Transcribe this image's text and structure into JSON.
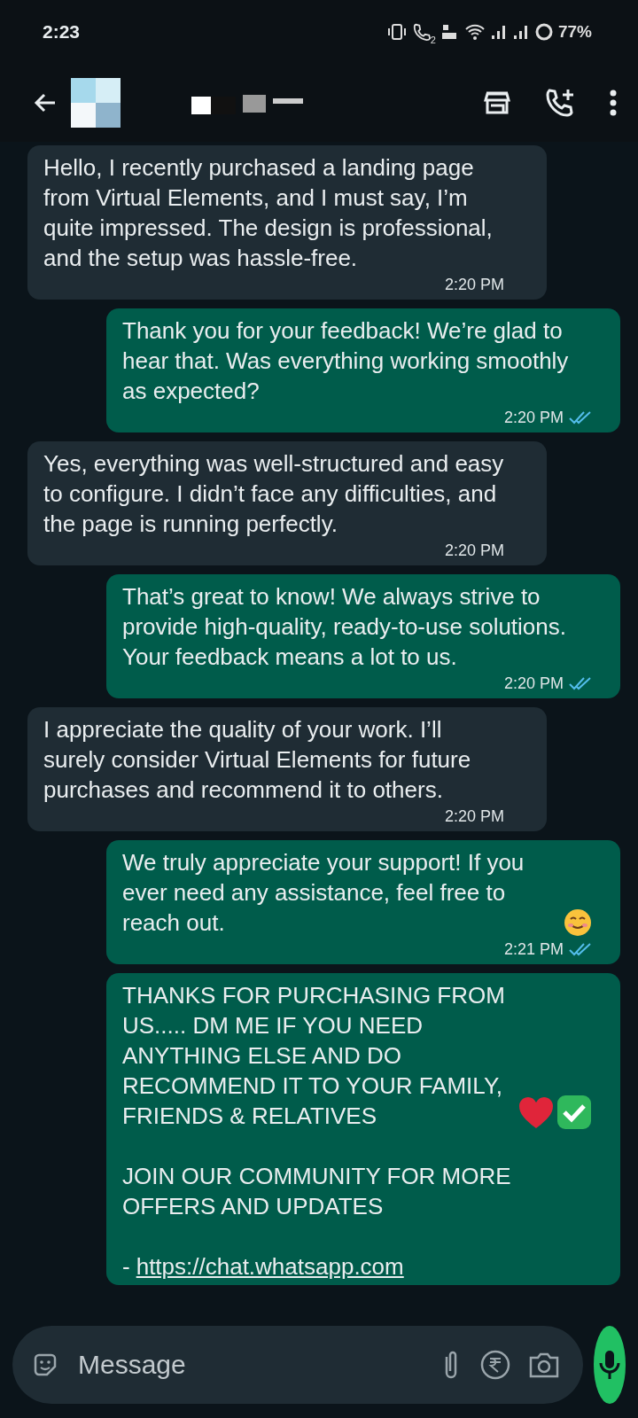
{
  "status_bar": {
    "time": "2:23",
    "signal_sim2": "2",
    "battery": "77%"
  },
  "header": {
    "name_redacted": true
  },
  "messages": [
    {
      "outgoing": false,
      "paragraphs": [
        [
          {
            "kind": "text",
            "text": "Hello, I recently purchased a landing page from Virtual Elements, and I must say, I’m quite impressed. The design is professional, and the setup was hassle-free."
          }
        ]
      ],
      "time": "2:20 PM"
    },
    {
      "outgoing": true,
      "paragraphs": [
        [
          {
            "kind": "text",
            "text": "Thank you for your feedback! We’re glad to hear that. Was everything working smoothly as expected?"
          }
        ]
      ],
      "time": "2:20 PM",
      "read": true
    },
    {
      "outgoing": false,
      "paragraphs": [
        [
          {
            "kind": "text",
            "text": "Yes, everything was well-structured and easy to configure. I didn’t face any difficulties, and the page is running perfectly."
          }
        ]
      ],
      "time": "2:20 PM"
    },
    {
      "outgoing": true,
      "paragraphs": [
        [
          {
            "kind": "text",
            "text": "That’s great to know! We always strive to provide high-quality, ready-to-use solutions. Your feedback means a lot to us."
          }
        ]
      ],
      "time": "2:20 PM",
      "read": true
    },
    {
      "outgoing": false,
      "paragraphs": [
        [
          {
            "kind": "text",
            "text": "I appreciate the quality of your work. I’ll surely consider Virtual Elements for future purchases and recommend it to others."
          }
        ]
      ],
      "time": "2:20 PM"
    },
    {
      "outgoing": true,
      "paragraphs": [
        [
          {
            "kind": "text",
            "text": "We truly appreciate your support! If you ever need any assistance, feel free to reach out."
          },
          {
            "kind": "smile-emoji"
          }
        ]
      ],
      "time": "2:21 PM",
      "read": true
    },
    {
      "outgoing": true,
      "paragraphs": [
        [
          {
            "kind": "text",
            "text": "THANKS FOR PURCHASING FROM US..... DM ME IF YOU NEED ANYTHING ELSE AND DO RECOMMEND IT TO YOUR FAMILY, FRIENDS & RELATIVES"
          },
          {
            "kind": "heart-emoji"
          },
          {
            "kind": "check-emoji"
          }
        ],
        [
          {
            "kind": "text",
            "text": "JOIN OUR COMMUNITY FOR MORE OFFERS AND UPDATES"
          }
        ],
        [
          {
            "kind": "text",
            "text": "-"
          },
          {
            "kind": "link",
            "text": "https://chat.whatsapp.com"
          }
        ]
      ]
    }
  ],
  "composer": {
    "placeholder": "Message"
  }
}
